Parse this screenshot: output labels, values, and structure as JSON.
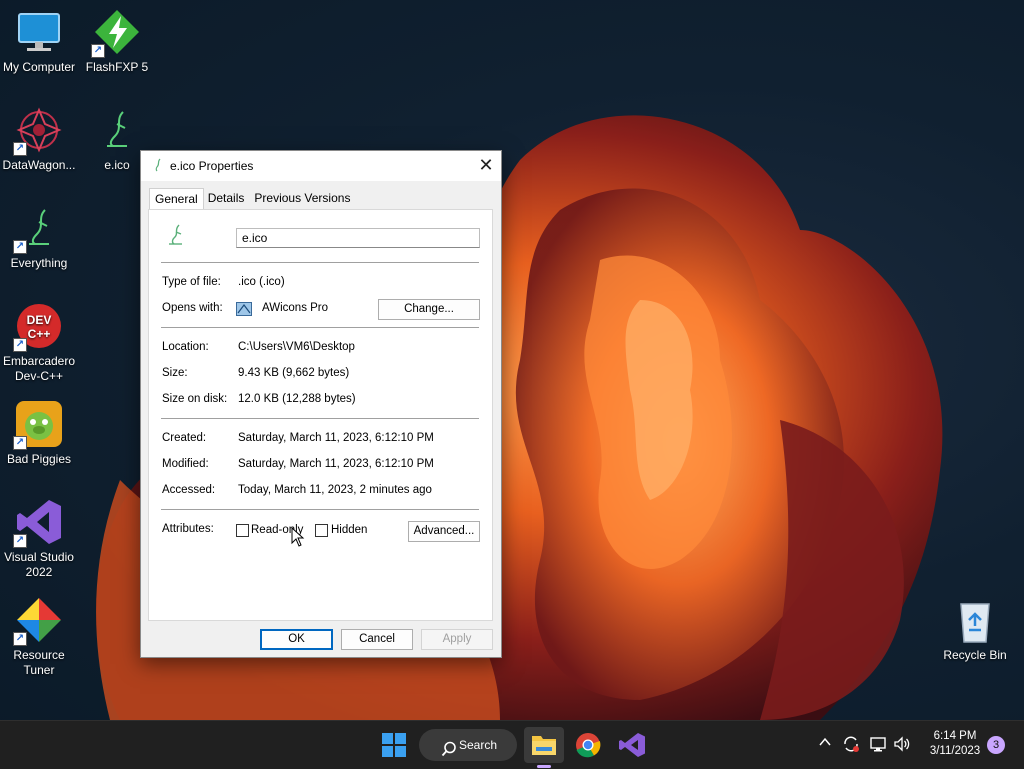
{
  "desktop": {
    "icons": [
      {
        "label": "My Computer"
      },
      {
        "label": "FlashFXP 5"
      },
      {
        "label": "DataWagon..."
      },
      {
        "label": "e.ico"
      },
      {
        "label": "Everything"
      },
      {
        "label": "Embarcadero Dev-C++"
      },
      {
        "label": "Bad Piggies"
      },
      {
        "label": "Visual Studio 2022"
      },
      {
        "label": "Resource Tuner"
      },
      {
        "label": "Recycle Bin"
      }
    ]
  },
  "dialog": {
    "title": "e.ico Properties",
    "close_glyph": "✕",
    "tabs": [
      "General",
      "Details",
      "Previous Versions"
    ],
    "active_tab": "General",
    "filename": "e.ico",
    "type_label": "Type of file:",
    "type_value": ".ico (.ico)",
    "opens_label": "Opens with:",
    "opens_value": "AWicons Pro",
    "change_button": "Change...",
    "location_label": "Location:",
    "location_value": "C:\\Users\\VM6\\Desktop",
    "size_label": "Size:",
    "size_value": "9.43 KB (9,662 bytes)",
    "size_disk_label": "Size on disk:",
    "size_disk_value": "12.0 KB (12,288 bytes)",
    "created_label": "Created:",
    "created_value": "Saturday, March 11, 2023, 6:12:10 PM",
    "modified_label": "Modified:",
    "modified_value": "Saturday, March 11, 2023, 6:12:10 PM",
    "accessed_label": "Accessed:",
    "accessed_value": "Today, March 11, 2023, 2 minutes ago",
    "attributes_label": "Attributes:",
    "readonly_label": "Read-only",
    "hidden_label": "Hidden",
    "advanced_button": "Advanced...",
    "ok_button": "OK",
    "cancel_button": "Cancel",
    "apply_button": "Apply"
  },
  "taskbar": {
    "search_label": "Search",
    "time": "6:14 PM",
    "date": "3/11/2023",
    "notification_count": "3"
  }
}
